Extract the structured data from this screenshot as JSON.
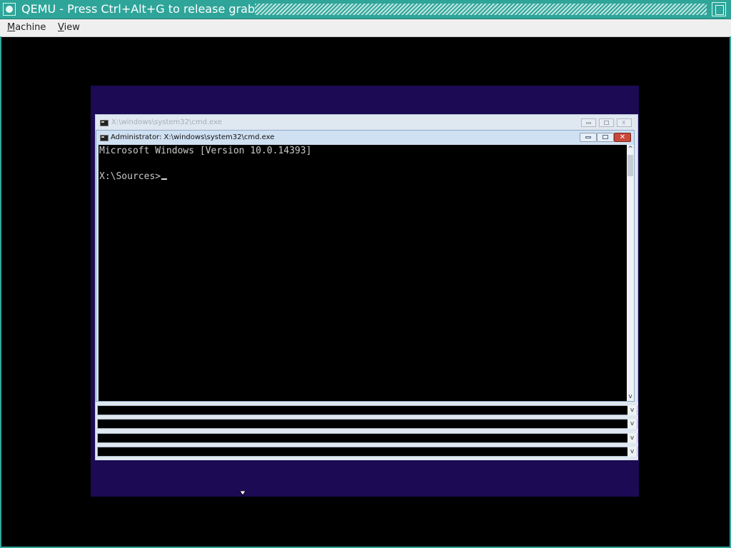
{
  "qemu": {
    "title": "QEMU - Press Ctrl+Alt+G to release grab",
    "menu": [
      {
        "label_first": "M",
        "label_rest": "achine"
      },
      {
        "label_first": "V",
        "label_rest": "iew"
      }
    ]
  },
  "guest": {
    "background_window": {
      "title": "X:\\windows\\system32\\cmd.exe"
    },
    "foreground_window": {
      "title": "Administrator: X:\\windows\\system32\\cmd.exe",
      "close_glyph": "✕",
      "console_lines": [
        "Microsoft Windows [Version 10.0.14393]",
        "",
        "X:\\Sources>"
      ]
    },
    "scroll_up_glyph": "^",
    "scroll_down_glyph": "v",
    "dropdown_glyph": "v"
  },
  "colors": {
    "qemu_accent": "#2fa59a",
    "guest_desktop": "#1c0a55",
    "console_bg": "#000000",
    "console_text": "#c8c8c8"
  }
}
